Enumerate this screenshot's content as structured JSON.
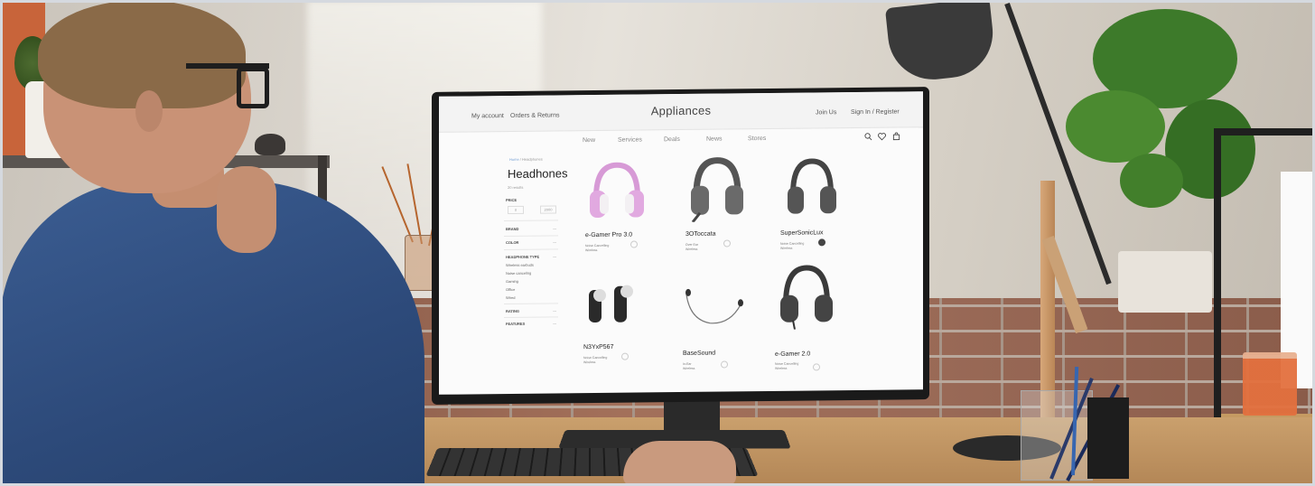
{
  "store": {
    "brand": "Appliances",
    "top_links_left": [
      "My account",
      "Orders & Returns"
    ],
    "top_links_right": [
      "Join Us",
      "Sign In / Register"
    ],
    "nav": [
      "New",
      "Services",
      "Deals",
      "News",
      "Stores"
    ],
    "icons": [
      "search-icon",
      "heart-icon",
      "bag-icon"
    ]
  },
  "sidebar": {
    "breadcrumb_home": "Home",
    "breadcrumb_sep": "/",
    "breadcrumb_current": "Headphones",
    "title": "Headhones",
    "results": "20 results",
    "price_label": "PRICE",
    "price_min": "0",
    "price_max": "2000",
    "filters": [
      "BRAND",
      "COLOR",
      "HEADPHONE TYPE"
    ],
    "headphone_types": [
      "Wireless earbuds",
      "Noise canceling",
      "Gaming",
      "Office",
      "Wired"
    ],
    "more_filters": [
      "RATING",
      "FEATURES"
    ]
  },
  "products": [
    {
      "name": "e-Gamer Pro 3.0",
      "features": [
        "Noise Cancelling",
        "Wireless"
      ],
      "color": "#d79ad6"
    },
    {
      "name": "3OToccata",
      "features": [
        "Over Ear",
        "Wireless"
      ],
      "color": "#6a6a6a"
    },
    {
      "name": "SuperSonicLux",
      "features": [
        "Noise Cancelling",
        "Wireless"
      ],
      "color": "#555555"
    },
    {
      "name": "N3YxP567",
      "features": [
        "Noise Cancelling",
        "Wireless"
      ],
      "color": "#333333"
    },
    {
      "name": "BaseSound",
      "features": [
        "In-Ear",
        "Wireless"
      ],
      "color": "#444444"
    },
    {
      "name": "e-Gamer 2.0",
      "features": [
        "Noise Cancelling",
        "Wireless"
      ],
      "color": "#3a3a3a"
    }
  ]
}
